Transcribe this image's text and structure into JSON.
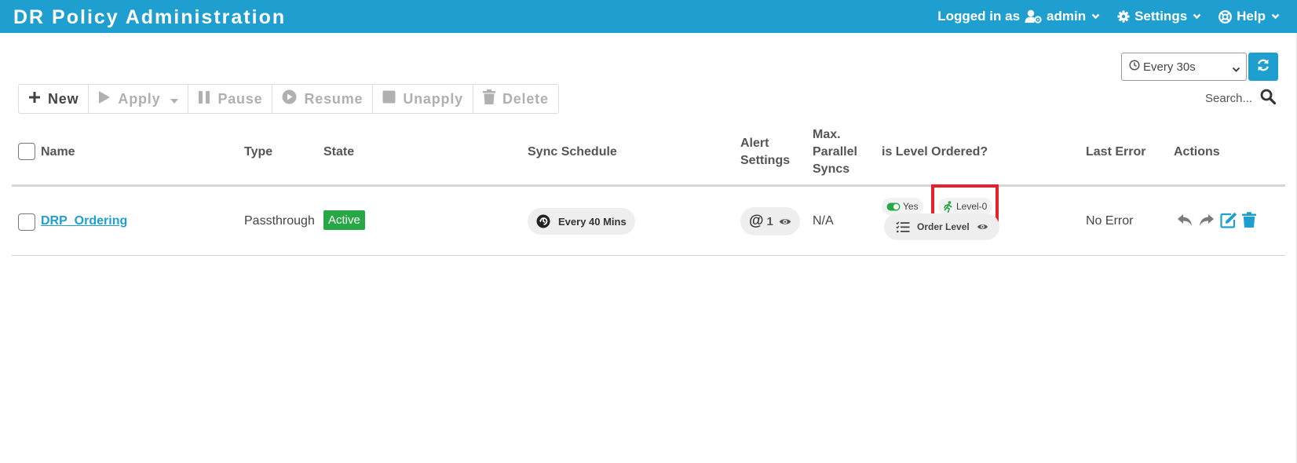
{
  "header": {
    "title": "DR Policy Administration",
    "logged_in_label": "Logged in as",
    "user": "admin",
    "settings_label": "Settings",
    "help_label": "Help",
    "background": "#1e9fd0"
  },
  "controls": {
    "refresh_interval": "Every 30s",
    "search_placeholder": "Search..."
  },
  "toolbar": {
    "new_label": "New",
    "apply_label": "Apply",
    "pause_label": "Pause",
    "resume_label": "Resume",
    "unapply_label": "Unapply",
    "delete_label": "Delete"
  },
  "table": {
    "columns": {
      "name": "Name",
      "type": "Type",
      "state": "State",
      "sync_schedule": "Sync Schedule",
      "alert_line1": "Alert",
      "alert_line2": "Settings",
      "maxpar_line1": "Max.",
      "maxpar_line2": "Parallel",
      "maxpar_line3": "Syncs",
      "level_ordered": "is Level Ordered?",
      "last_error": "Last Error",
      "actions": "Actions"
    },
    "rows": [
      {
        "name": "DRP_Ordering",
        "type": "Passthrough",
        "state": "Active",
        "sync_schedule": "Every 40 Mins",
        "alert_count": "1",
        "max_parallel": "N/A",
        "level_ordered": "Yes",
        "level": "Level-0",
        "order_level_label": "Order Level",
        "last_error": "No Error"
      }
    ]
  },
  "colors": {
    "accent": "#1e9fd0",
    "active_badge": "#28a745",
    "toggle_on": "#28a745",
    "highlight": "#e8202a",
    "level_icon": "#28a745"
  },
  "icons": {
    "user": "user-cog-icon",
    "settings": "gear-icon",
    "help": "life-ring-icon",
    "clock": "clock-icon",
    "refresh": "refresh-icon",
    "search": "search-icon",
    "schedule": "sync-schedule-icon",
    "alert": "at-icon",
    "view": "eye-icon",
    "level": "running-person-icon",
    "order": "list-check-icon",
    "undo": "undo-icon",
    "redo": "redo-icon",
    "edit": "edit-icon",
    "trash": "trash-icon"
  }
}
